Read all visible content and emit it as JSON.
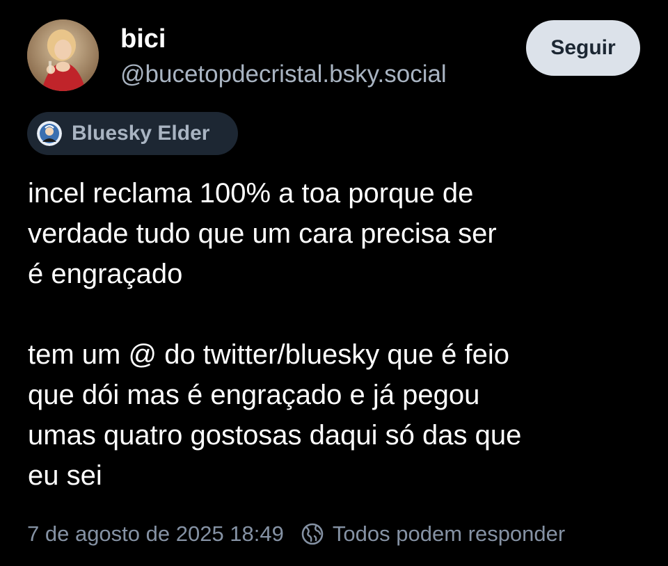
{
  "author": {
    "display_name": "bici",
    "handle": "@bucetopdecristal.bsky.social",
    "avatar_icon": "avatar-photo"
  },
  "follow_button": {
    "label": "Seguir"
  },
  "badge": {
    "label": "Bluesky Elder",
    "icon": "bluesky-elder-badge-icon"
  },
  "post": {
    "paragraphs": [
      {
        "lines": [
          "incel reclama 100% a toa porque de",
          "verdade tudo que um cara precisa ser",
          "é engraçado"
        ]
      },
      {
        "lines": [
          "tem um @ do twitter/bluesky que é feio",
          "que dói mas é engraçado e já pegou",
          "umas quatro gostosas daqui só das que",
          "eu sei"
        ]
      }
    ]
  },
  "footer": {
    "timestamp": "7 de agosto de 2025 18:49",
    "reply_setting": "Todos podem responder",
    "reply_icon": "earth-icon"
  },
  "colors": {
    "background": "#000000",
    "text": "#ffffff",
    "muted": "#a9b4c2",
    "footer_muted": "#8592a4",
    "button_bg": "#dce2ea",
    "badge_bg": "#1d2733"
  }
}
